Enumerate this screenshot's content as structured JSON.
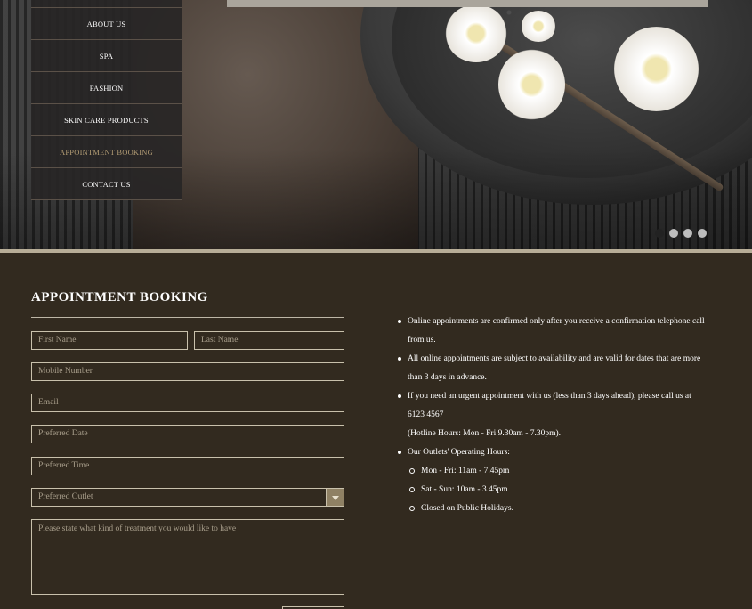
{
  "nav": {
    "items": [
      {
        "label": "ABOUT US"
      },
      {
        "label": "SPA"
      },
      {
        "label": "FASHION"
      },
      {
        "label": "SKIN CARE PRODUCTS"
      },
      {
        "label": "APPOINTMENT BOOKING",
        "active": true
      },
      {
        "label": "CONTACT US"
      }
    ]
  },
  "slider": {
    "total_slides": 4,
    "active_slide": 1
  },
  "booking": {
    "title": "APPOINTMENT BOOKING",
    "first_name_placeholder": "First Name",
    "last_name_placeholder": "Last Name",
    "mobile_placeholder": "Mobile Number",
    "email_placeholder": "Email",
    "date_placeholder": "Preferred Date",
    "time_placeholder": "Preferred Time",
    "outlet_selected": "Preferred Outlet",
    "message_placeholder": "Please state what kind of treatment you would like to have"
  },
  "info": {
    "b1_line1": "Online appointments are confirmed only after you receive a confirmation telephone call",
    "b1_line2": "from us.",
    "b2_line1": "All online appointments are subject to availability and are valid for dates that are more",
    "b2_line2": "than 3 days in advance.",
    "b3_line1": "If you need an urgent appointment with us (less than 3 days ahead), please call us at",
    "b3_line2": "6123 4567",
    "b3_line3": "(Hotline Hours: Mon - Fri 9.30am - 7.30pm).",
    "b4": "Our Outlets' Operating Hours:",
    "hours": [
      "Mon - Fri: 11am - 7.45pm",
      "Sat - Sun: 10am - 3.45pm",
      "Closed on Public Holidays."
    ]
  },
  "colors": {
    "background": "#322a1f",
    "accent": "#b29c74",
    "field_border": "#c9c1ac",
    "text": "#ffffff"
  }
}
